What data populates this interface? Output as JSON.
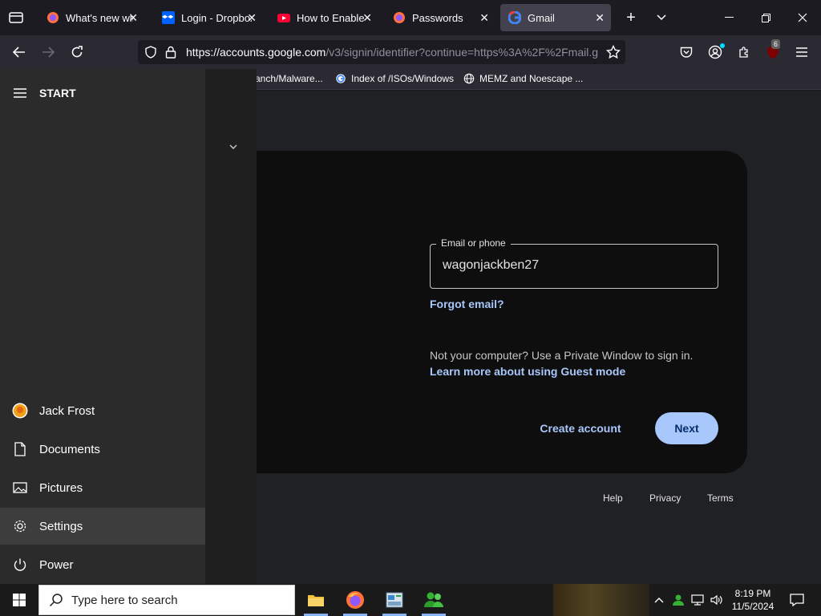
{
  "browser": {
    "tabs": [
      {
        "title": "What's new with",
        "icon": "firefox-icon",
        "active": false
      },
      {
        "title": "Login - Dropbox",
        "icon": "dropbox-icon",
        "active": false
      },
      {
        "title": "How to Enable t",
        "icon": "youtube-icon",
        "active": false
      },
      {
        "title": "Passwords",
        "icon": "firefox-icon",
        "active": false
      },
      {
        "title": "Gmail",
        "icon": "google-icon",
        "active": true
      }
    ],
    "url_host": "https://accounts.google.com",
    "url_rest": "/v3/signin/identifier?continue=https%3A%2F%2Fmail.g",
    "extension_badge": "6",
    "bookmarks": [
      {
        "label": "anch/Malware..."
      },
      {
        "label": "Index of /ISOs/Windows",
        "icon": "google-icon"
      },
      {
        "label": "MEMZ and Noescape ...",
        "icon": "globe-icon"
      }
    ]
  },
  "signin": {
    "email_label": "Email or phone",
    "email_value": "wagonjackben27",
    "forgot_email": "Forgot email?",
    "not_your_computer": "Not your computer? Use a Private Window to sign in.",
    "learn_more": "Learn more about using Guest mode",
    "create_account": "Create account",
    "next": "Next"
  },
  "footer": {
    "help": "Help",
    "privacy": "Privacy",
    "terms": "Terms"
  },
  "start_menu": {
    "title": "START",
    "items": [
      {
        "label": "Jack Frost",
        "icon": "user-avatar-icon"
      },
      {
        "label": "Documents",
        "icon": "document-icon"
      },
      {
        "label": "Pictures",
        "icon": "pictures-icon"
      },
      {
        "label": "Settings",
        "icon": "gear-icon"
      },
      {
        "label": "Power",
        "icon": "power-icon"
      }
    ]
  },
  "taskbar": {
    "search_placeholder": "Type here to search",
    "time": "8:19 PM",
    "date": "11/5/2024"
  },
  "colors": {
    "accent_link": "#a8c7fa",
    "next_button": "#a8c7fa",
    "card_bg": "#0e0e0e",
    "start_bg": "#2b2b2b"
  }
}
